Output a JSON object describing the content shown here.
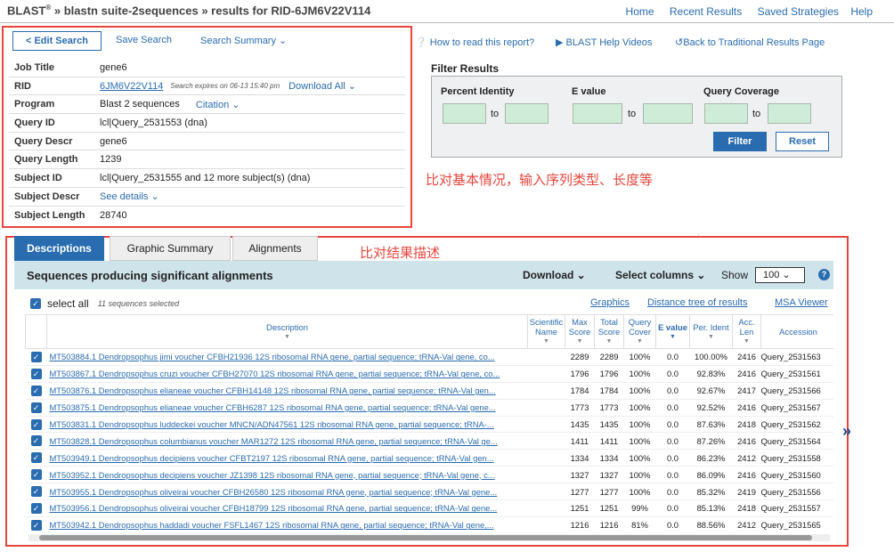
{
  "header": {
    "brand": "BLAST",
    "brand_sup": "®",
    "breadcrumb": "» blastn suite-2sequences » results for RID-6JM6V22V114",
    "nav": [
      "Home",
      "Recent Results",
      "Saved Strategies",
      "Help"
    ]
  },
  "job": {
    "edit": "< Edit Search",
    "save": "Save Search",
    "summary": "Search Summary ⌄",
    "rows": [
      {
        "k": "Job Title",
        "v": "gene6"
      },
      {
        "k": "RID",
        "v": "6JM6V22V114",
        "note": "Search expires on 06-13 15:40 pm",
        "extra": "Download All ⌄"
      },
      {
        "k": "Program",
        "v": "Blast 2 sequences",
        "extra": "Citation ⌄"
      },
      {
        "k": "Query ID",
        "v": "lcl|Query_2531553 (dna)"
      },
      {
        "k": "Query Descr",
        "v": "gene6"
      },
      {
        "k": "Query Length",
        "v": "1239"
      },
      {
        "k": "Subject ID",
        "v": "lcl|Query_2531555 and 12 more subject(s) (dna)"
      },
      {
        "k": "Subject Descr",
        "v": "See details ⌄"
      },
      {
        "k": "Subject Length",
        "v": "28740"
      }
    ]
  },
  "toplinks": [
    "How to read this report?",
    "BLAST Help Videos",
    "Back to Traditional Results Page"
  ],
  "filter": {
    "title": "Filter Results",
    "labels": [
      "Percent Identity",
      "E value",
      "Query Coverage"
    ],
    "to": "to",
    "filter_btn": "Filter",
    "reset_btn": "Reset"
  },
  "annot": {
    "a1": "比对基本情况，输入序列类型、长度等",
    "a2": "比对结果描述"
  },
  "tabs": [
    "Descriptions",
    "Graphic Summary",
    "Alignments"
  ],
  "results": {
    "title": "Sequences producing significant alignments",
    "download": "Download ⌄",
    "select_cols": "Select columns ⌄",
    "show": "Show",
    "show_val": "100 ⌄",
    "select_all": "select all",
    "selected": "11 sequences selected",
    "links": [
      "Graphics",
      "Distance tree of results",
      "MSA Viewer"
    ],
    "cols": [
      "Description",
      "Scientific Name",
      "Max Score",
      "Total Score",
      "Query Cover",
      "E value",
      "Per. Ident",
      "Acc. Len",
      "Accession"
    ],
    "rows": [
      [
        "MT503884.1 Dendropsophus jimi voucher CFBH21936 12S ribosomal RNA gene, partial sequence; tRNA-Val gene, co...",
        "",
        "2289",
        "2289",
        "100%",
        "0.0",
        "100.00%",
        "2416",
        "Query_2531563"
      ],
      [
        "MT503867.1 Dendropsophus cruzi voucher CFBH27070 12S ribosomal RNA gene, partial sequence; tRNA-Val gene, co...",
        "",
        "1796",
        "1796",
        "100%",
        "0.0",
        "92.83%",
        "2416",
        "Query_2531561"
      ],
      [
        "MT503876.1 Dendropsophus elianeae voucher CFBH14148 12S ribosomal RNA gene, partial sequence; tRNA-Val gen...",
        "",
        "1784",
        "1784",
        "100%",
        "0.0",
        "92.67%",
        "2417",
        "Query_2531566"
      ],
      [
        "MT503875.1 Dendropsophus elianeae voucher CFBH6287 12S ribosomal RNA gene, partial sequence; tRNA-Val gene...",
        "",
        "1773",
        "1773",
        "100%",
        "0.0",
        "92.52%",
        "2416",
        "Query_2531567"
      ],
      [
        "MT503831.1 Dendropsophus luddeckei voucher MNCN/ADN47561 12S ribosomal RNA gene, partial sequence; tRNA-...",
        "",
        "1435",
        "1435",
        "100%",
        "0.0",
        "87.63%",
        "2418",
        "Query_2531562"
      ],
      [
        "MT503828.1 Dendropsophus columbianus voucher MAR1272 12S ribosomal RNA gene, partial sequence; tRNA-Val ge...",
        "",
        "1411",
        "1411",
        "100%",
        "0.0",
        "87.26%",
        "2416",
        "Query_2531564"
      ],
      [
        "MT503949.1 Dendropsophus decipiens voucher CFBT2197 12S ribosomal RNA gene, partial sequence; tRNA-Val gen...",
        "",
        "1334",
        "1334",
        "100%",
        "0.0",
        "86.23%",
        "2412",
        "Query_2531558"
      ],
      [
        "MT503952.1 Dendropsophus decipiens voucher JZ1398 12S ribosomal RNA gene, partial sequence; tRNA-Val gene, c...",
        "",
        "1327",
        "1327",
        "100%",
        "0.0",
        "86.09%",
        "2416",
        "Query_2531560"
      ],
      [
        "MT503955.1 Dendropsophus oliveirai voucher CFBH26580 12S ribosomal RNA gene, partial sequence; tRNA-Val gene...",
        "",
        "1277",
        "1277",
        "100%",
        "0.0",
        "85.32%",
        "2419",
        "Query_2531556"
      ],
      [
        "MT503956.1 Dendropsophus oliveirai voucher CFBH18799 12S ribosomal RNA gene, partial sequence; tRNA-Val gene...",
        "",
        "1251",
        "1251",
        "99%",
        "0.0",
        "85.13%",
        "2418",
        "Query_2531557"
      ],
      [
        "MT503942.1 Dendropsophus haddadi voucher FSFL1467 12S ribosomal RNA gene, partial sequence; tRNA-Val gene,...",
        "",
        "1216",
        "1216",
        "81%",
        "0.0",
        "88.56%",
        "2412",
        "Query_2531565"
      ]
    ]
  }
}
